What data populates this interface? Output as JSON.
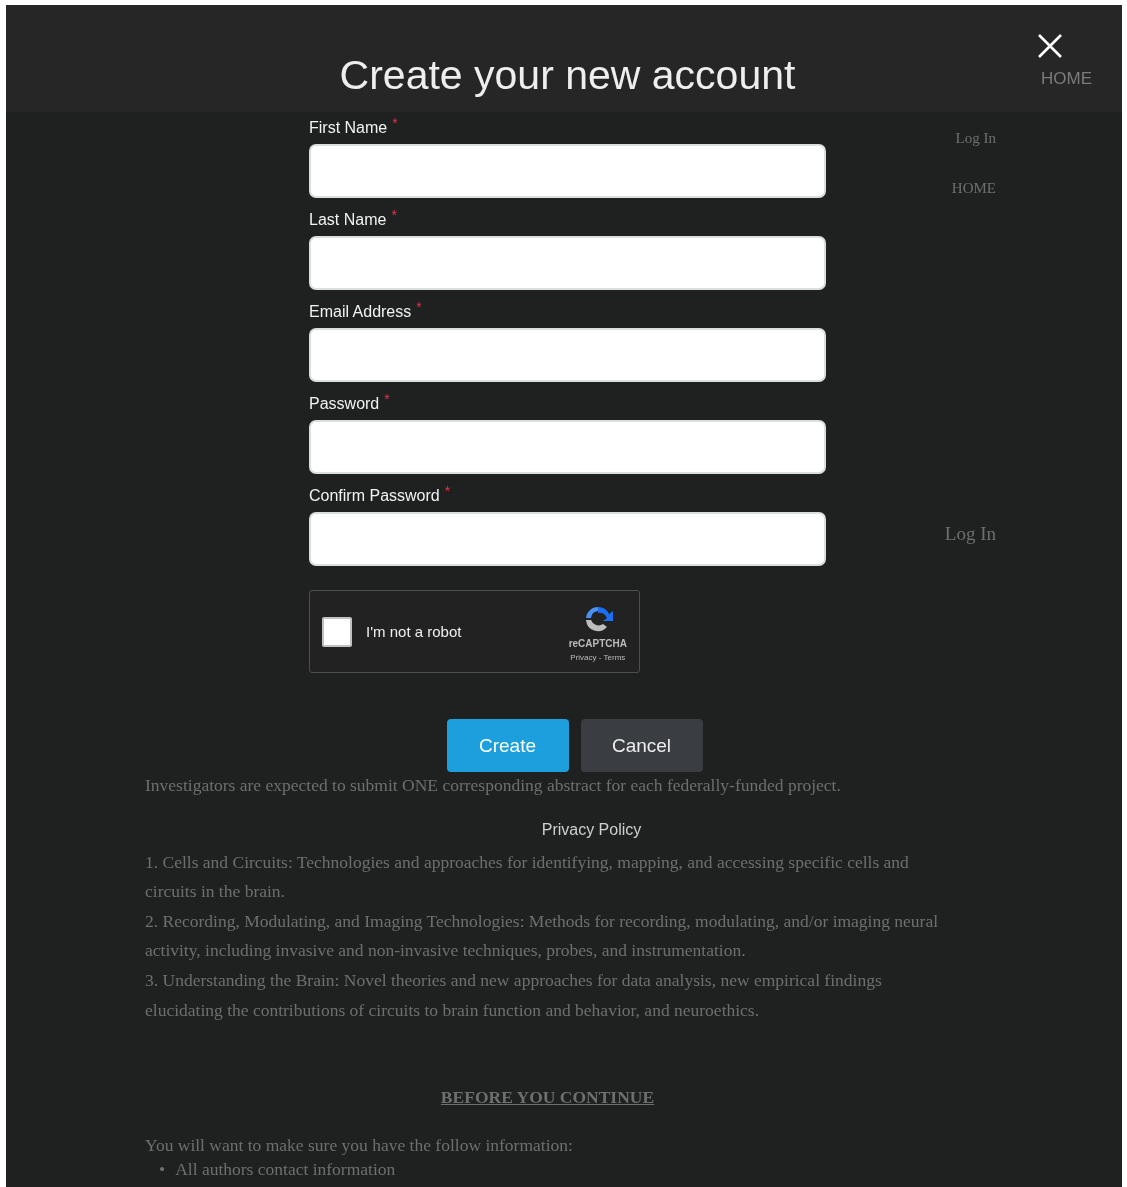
{
  "header": {
    "nav_link": "HOME"
  },
  "page": {
    "nav": [
      "Log In",
      "HOME"
    ],
    "login_link": "Log In",
    "paragraph_line": "Investigators are expected to submit ONE corresponding abstract for each federally-funded project.",
    "research_areas": [
      "1.  Cells and Circuits: Technologies and approaches for identifying, mapping, and accessing specific cells and circuits in the brain.",
      "2.  Recording, Modulating, and Imaging Technologies: Methods for recording, modulating, and/or imaging neural activity, including invasive and non-invasive techniques, probes, and instrumentation.",
      "3.  Understanding the Brain: Novel theories and new approaches for data analysis, new empirical findings elucidating the contributions of circuits to brain function and behavior, and neuroethics."
    ],
    "section_heading": "BEFORE YOU CONTINUE",
    "intro": "You will want to make sure you have the follow information:",
    "checklist": [
      {
        "marker": "•",
        "text": "All authors contact information"
      }
    ]
  },
  "modal": {
    "title": "Create your new account",
    "fields": [
      {
        "label": "First Name",
        "required_mark": "*"
      },
      {
        "label": "Last Name",
        "required_mark": "*"
      },
      {
        "label": "Email Address",
        "required_mark": "*"
      },
      {
        "label": "Password",
        "required_mark": "*"
      },
      {
        "label": "Confirm Password",
        "required_mark": "*"
      }
    ],
    "captcha": {
      "label": "I'm not a robot",
      "checked": false,
      "brand": "reCAPTCHA",
      "links": "Privacy - Terms"
    },
    "buttons": [
      {
        "label": "Create",
        "kind": "primary"
      },
      {
        "label": "Cancel",
        "kind": "secondary"
      }
    ],
    "privacy_link": "Privacy Policy"
  }
}
